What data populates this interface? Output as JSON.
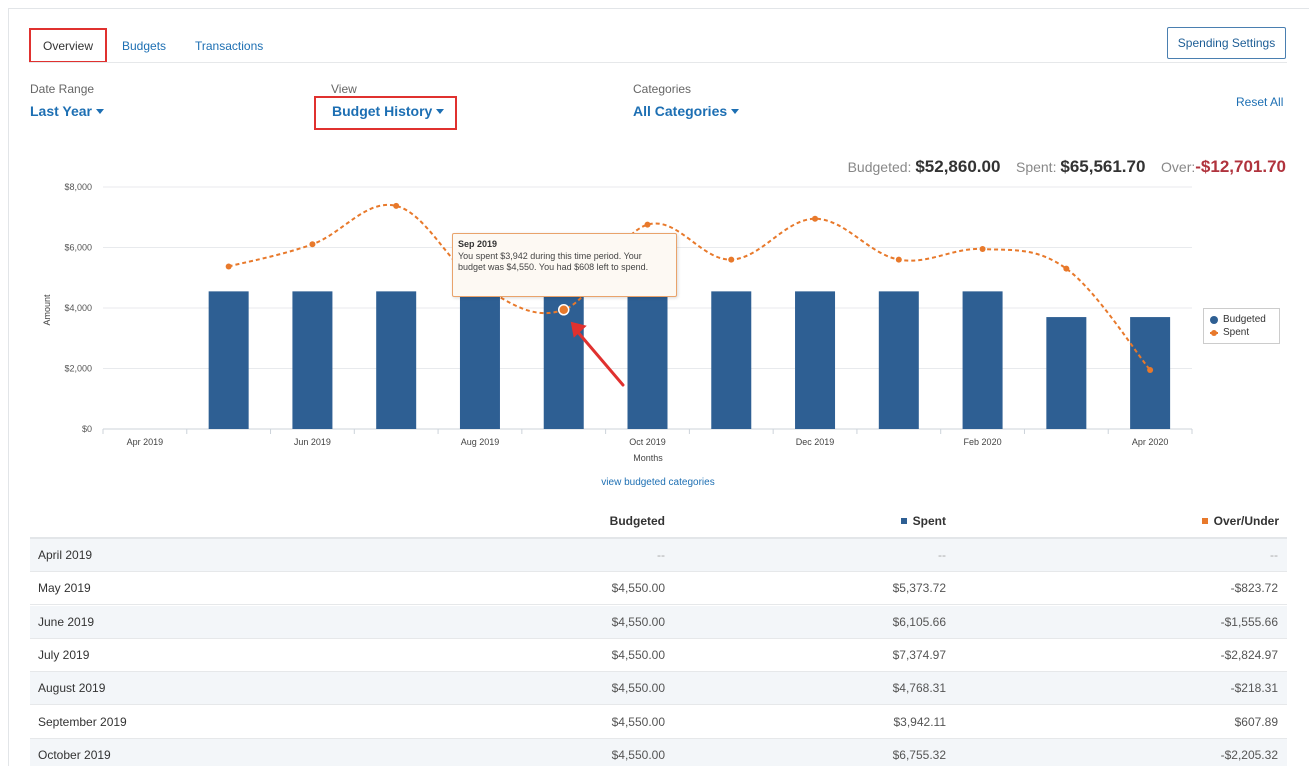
{
  "tabs": [
    {
      "label": "Overview",
      "active": true
    },
    {
      "label": "Budgets",
      "active": false
    },
    {
      "label": "Transactions",
      "active": false
    }
  ],
  "settings_button": "Spending Settings",
  "filters": {
    "date_range": {
      "label": "Date Range",
      "value": "Last Year"
    },
    "view": {
      "label": "View",
      "value": "Budget History"
    },
    "categories": {
      "label": "Categories",
      "value": "All Categories"
    }
  },
  "reset_label": "Reset All",
  "summary": {
    "budgeted_label": "Budgeted:",
    "budgeted_value": "$52,860.00",
    "spent_label": "Spent:",
    "spent_value": "$65,561.70",
    "over_label": "Over:",
    "over_value": "-$12,701.70"
  },
  "chart_data": {
    "type": "bar",
    "xlabel": "Months",
    "ylabel": "Amount",
    "ylim": [
      0,
      8000
    ],
    "y_ticks": [
      "$0",
      "$2,000",
      "$4,000",
      "$6,000",
      "$8,000"
    ],
    "categories": [
      "Apr 2019",
      "May 2019",
      "Jun 2019",
      "Jul 2019",
      "Aug 2019",
      "Sep 2019",
      "Oct 2019",
      "Nov 2019",
      "Dec 2019",
      "Jan 2020",
      "Feb 2020",
      "Mar 2020",
      "Apr 2020"
    ],
    "x_tick_labels": [
      "Apr 2019",
      "",
      "Jun 2019",
      "",
      "Aug 2019",
      "",
      "Oct 2019",
      "",
      "Dec 2019",
      "",
      "Feb 2020",
      "",
      "Apr 2020"
    ],
    "series": [
      {
        "name": "Budgeted",
        "type": "bar",
        "color": "#2e5f93",
        "values": [
          null,
          4550,
          4550,
          4550,
          4550,
          4550,
          4550,
          4550,
          4550,
          4550,
          4550,
          3700,
          3700
        ]
      },
      {
        "name": "Spent",
        "type": "line",
        "color": "#e8792b",
        "values": [
          null,
          5373.72,
          6105.66,
          7374.97,
          4768.31,
          3942.11,
          6755.32,
          5600,
          6950,
          5600,
          5950,
          5300,
          1950
        ]
      }
    ],
    "grid": true,
    "legend": "right"
  },
  "tooltip": {
    "title": "Sep 2019",
    "text": "You spent $3,942 during this time period. Your budget was $4,550. You had $608 left to spend."
  },
  "view_link": "view budgeted categories",
  "table": {
    "headers": {
      "budgeted": "Budgeted",
      "spent": "Spent",
      "over": "Over/Under"
    },
    "rows": [
      {
        "month": "April 2019",
        "budgeted": "--",
        "spent": "--",
        "over": "--"
      },
      {
        "month": "May 2019",
        "budgeted": "$4,550.00",
        "spent": "$5,373.72",
        "over": "-$823.72"
      },
      {
        "month": "June 2019",
        "budgeted": "$4,550.00",
        "spent": "$6,105.66",
        "over": "-$1,555.66"
      },
      {
        "month": "July 2019",
        "budgeted": "$4,550.00",
        "spent": "$7,374.97",
        "over": "-$2,824.97"
      },
      {
        "month": "August 2019",
        "budgeted": "$4,550.00",
        "spent": "$4,768.31",
        "over": "-$218.31"
      },
      {
        "month": "September 2019",
        "budgeted": "$4,550.00",
        "spent": "$3,942.11",
        "over": "$607.89"
      },
      {
        "month": "October 2019",
        "budgeted": "$4,550.00",
        "spent": "$6,755.32",
        "over": "-$2,205.32"
      }
    ]
  }
}
